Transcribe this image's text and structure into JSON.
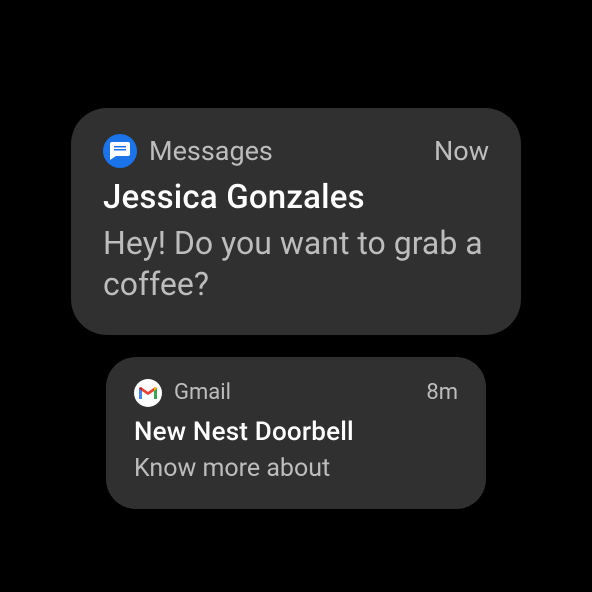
{
  "notifications": [
    {
      "app": "Messages",
      "icon": "messages-icon",
      "timestamp": "Now",
      "sender": "Jessica Gonzales",
      "body": "Hey! Do you want to grab a coffee?"
    },
    {
      "app": "Gmail",
      "icon": "gmail-icon",
      "timestamp": "8m",
      "sender": "New Nest Doorbell",
      "body": "Know more about"
    }
  ]
}
